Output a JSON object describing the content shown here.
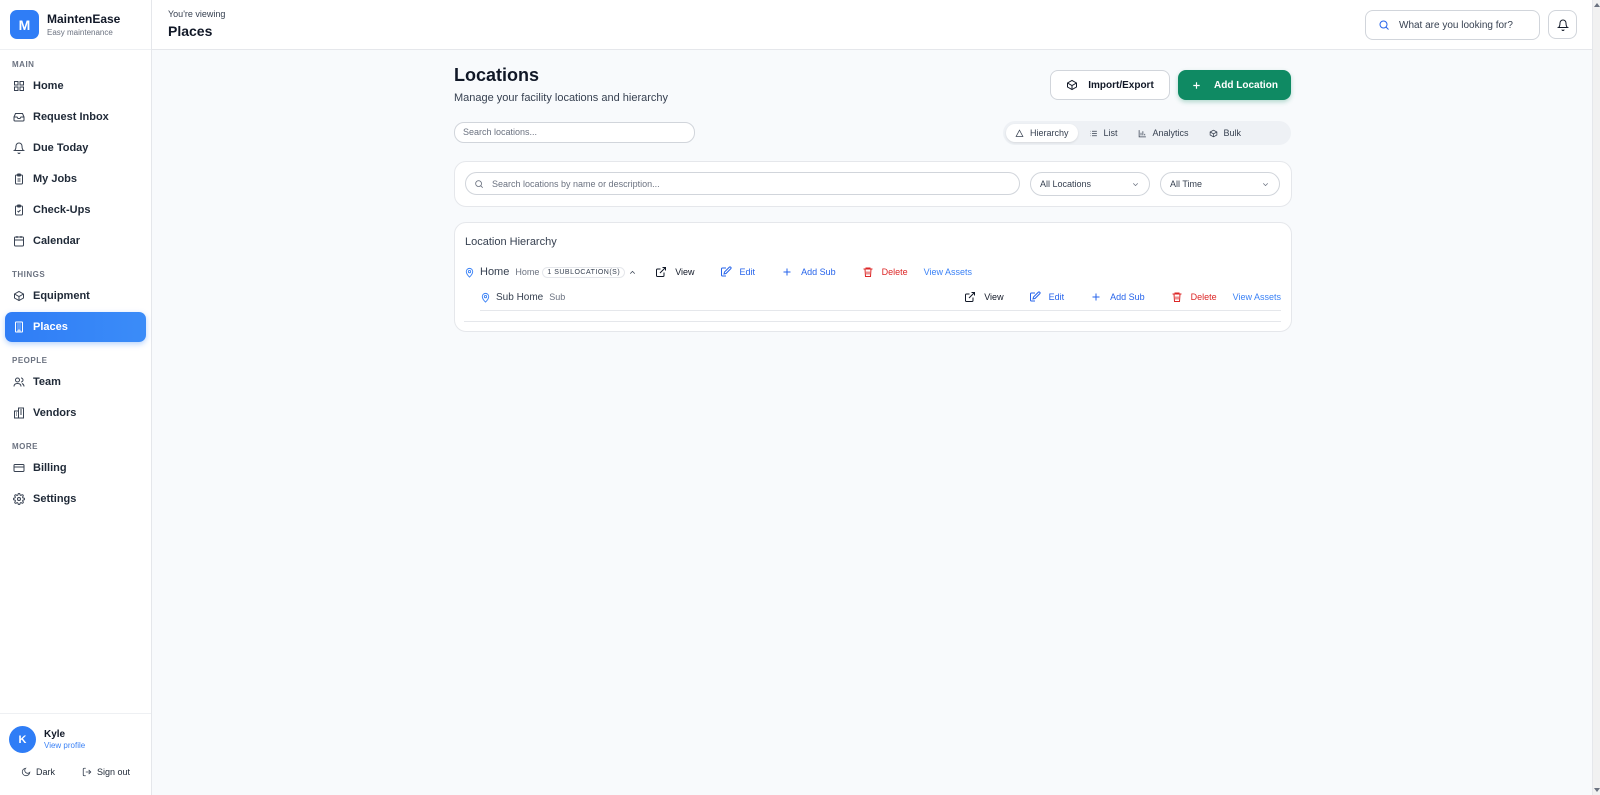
{
  "app": {
    "logo_letter": "M",
    "name": "MaintenEase",
    "tagline": "Easy maintenance"
  },
  "sidebar": {
    "sections": [
      {
        "label": "MAIN"
      },
      {
        "label": "THINGS"
      },
      {
        "label": "PEOPLE"
      },
      {
        "label": "MORE"
      }
    ],
    "items": [
      {
        "label": "Home",
        "icon": "grid-icon"
      },
      {
        "label": "Request Inbox",
        "icon": "inbox-icon"
      },
      {
        "label": "Due Today",
        "icon": "bell-icon"
      },
      {
        "label": "My Jobs",
        "icon": "clipboard-icon"
      },
      {
        "label": "Check-Ups",
        "icon": "clipboard-check-icon"
      },
      {
        "label": "Calendar",
        "icon": "calendar-icon"
      },
      {
        "label": "Equipment",
        "icon": "box-icon"
      },
      {
        "label": "Places",
        "icon": "building-icon",
        "active": true
      },
      {
        "label": "Team",
        "icon": "users-icon"
      },
      {
        "label": "Vendors",
        "icon": "buildings-icon"
      },
      {
        "label": "Billing",
        "icon": "credit-card-icon"
      },
      {
        "label": "Settings",
        "icon": "gear-icon"
      }
    ],
    "user": {
      "initial": "K",
      "name": "Kyle",
      "link": "View profile"
    },
    "footer": {
      "theme_label": "Dark",
      "signout_label": "Sign out"
    }
  },
  "header": {
    "context_label": "You're viewing",
    "title": "Places",
    "search_placeholder": "What are you looking for?"
  },
  "page": {
    "title": "Locations",
    "subtitle": "Manage your facility locations and hierarchy",
    "import_label": "Import/Export",
    "add_label": "Add Location",
    "search_placeholder": "Search locations...",
    "view_tabs": [
      {
        "label": "Hierarchy",
        "icon": "tree-icon",
        "active": true
      },
      {
        "label": "List",
        "icon": "list-icon"
      },
      {
        "label": "Analytics",
        "icon": "bar-chart-icon"
      },
      {
        "label": "Bulk",
        "icon": "box-icon"
      }
    ],
    "filters": {
      "search_placeholder": "Search locations by name or description...",
      "location_select": "All Locations",
      "time_select": "All Time"
    },
    "hierarchy": {
      "title": "Location Hierarchy",
      "rows": [
        {
          "name": "Home",
          "type": "Home",
          "badge": "1 SUBLOCATION(S)"
        },
        {
          "name": "Sub Home",
          "type": "Sub"
        }
      ],
      "actions": {
        "view": "View",
        "edit": "Edit",
        "add_sub": "Add Sub",
        "delete": "Delete",
        "view_assets": "View Assets"
      }
    }
  },
  "colors": {
    "primary": "#2f7df6",
    "success": "#0f8a63",
    "danger": "#dc2626"
  }
}
